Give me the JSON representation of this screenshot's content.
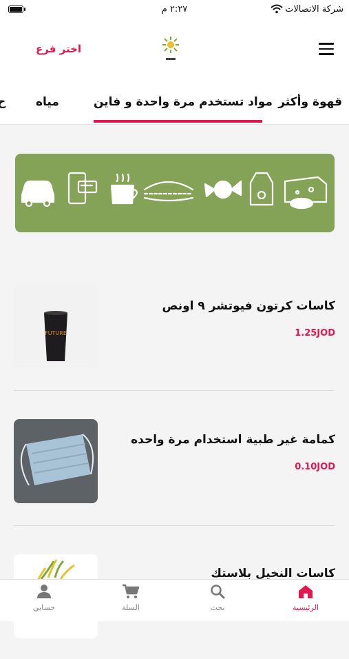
{
  "status_bar": {
    "carrier": "شركة الاتصالات",
    "time": "٢:٢٧ م"
  },
  "header": {
    "branch_label": "اختر فرع"
  },
  "tabs": [
    {
      "label": "قهوة وأكثر"
    },
    {
      "label": "مواد تستخدم مرة واحدة و فاين",
      "active": true
    },
    {
      "label": "مياه"
    },
    {
      "label": "ح"
    }
  ],
  "banner": {
    "icons": [
      "car-icon",
      "mobile-payment-icon",
      "coffee-cup-icon",
      "sandwich-icon",
      "candy-icon",
      "milk-carton-icon",
      "cheese-icon"
    ]
  },
  "products": [
    {
      "name": "كاسات كرتون فيوتشر ٩ اونص",
      "price": "1.25JOD",
      "image_text": "FUTURE"
    },
    {
      "name": "كمامة غير طبية استخدام مرة واحده",
      "price": "0.10JOD"
    },
    {
      "name": "كاسات النخيل بلاستك",
      "price": ""
    }
  ],
  "bottom_nav": [
    {
      "label": "الرئيسية",
      "icon": "home-icon",
      "active": true
    },
    {
      "label": "بحث",
      "icon": "search-icon"
    },
    {
      "label": "السلة",
      "icon": "cart-icon"
    },
    {
      "label": "حسابي",
      "icon": "user-icon"
    }
  ],
  "colors": {
    "accent": "#e0184f",
    "banner": "#84a357"
  }
}
